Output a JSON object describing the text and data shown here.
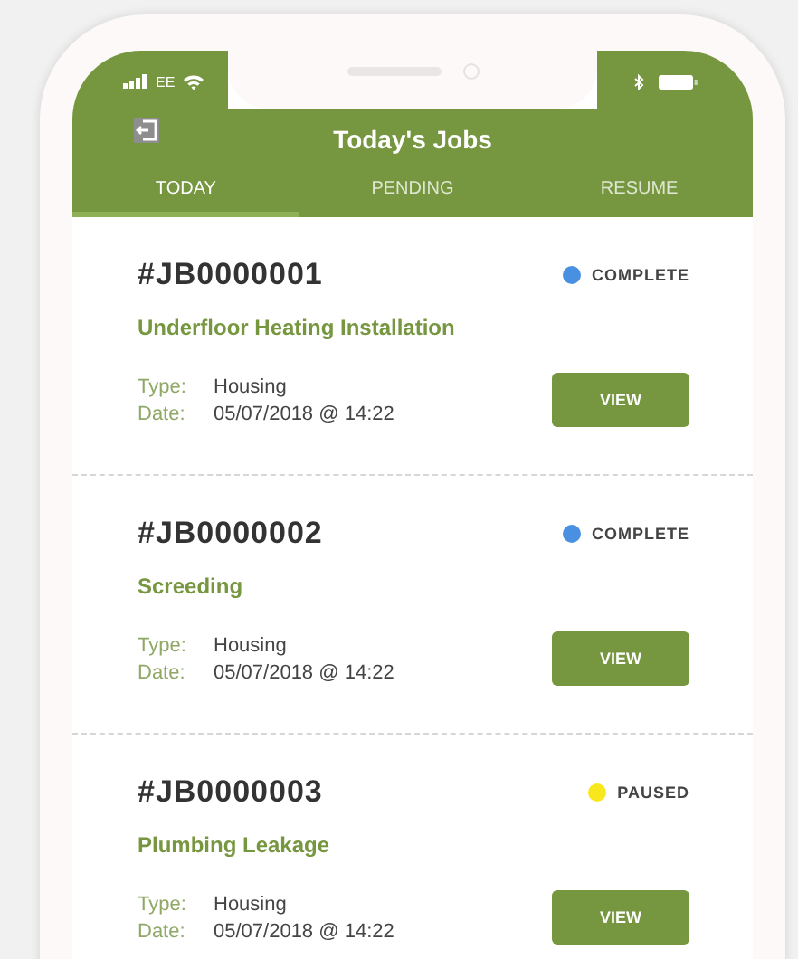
{
  "status_bar": {
    "carrier": "EE"
  },
  "header": {
    "title": "Today's Jobs"
  },
  "tabs": [
    {
      "label": "TODAY",
      "selected": true
    },
    {
      "label": "PENDING",
      "selected": false
    },
    {
      "label": "RESUME",
      "selected": false
    }
  ],
  "jobs": [
    {
      "id": "#JB0000001",
      "status": "COMPLETE",
      "color": "#4a90e2",
      "title": "Underfloor Heating Installation",
      "type_label": "Type:",
      "type": "Housing",
      "date_label": "Date:",
      "date": "05/07/2018 @ 14:22",
      "button": "VIEW"
    },
    {
      "id": "#JB0000002",
      "status": "COMPLETE",
      "color": "#4a90e2",
      "title": "Screeding",
      "type_label": "Type:",
      "type": "Housing",
      "date_label": "Date:",
      "date": "05/07/2018 @ 14:22",
      "button": "VIEW"
    },
    {
      "id": "#JB0000003",
      "status": "PAUSED",
      "color": "#f8e71c",
      "title": "Plumbing Leakage",
      "type_label": "Type:",
      "type": "Housing",
      "date_label": "Date:",
      "date": "05/07/2018 @ 14:22",
      "button": "VIEW"
    }
  ]
}
